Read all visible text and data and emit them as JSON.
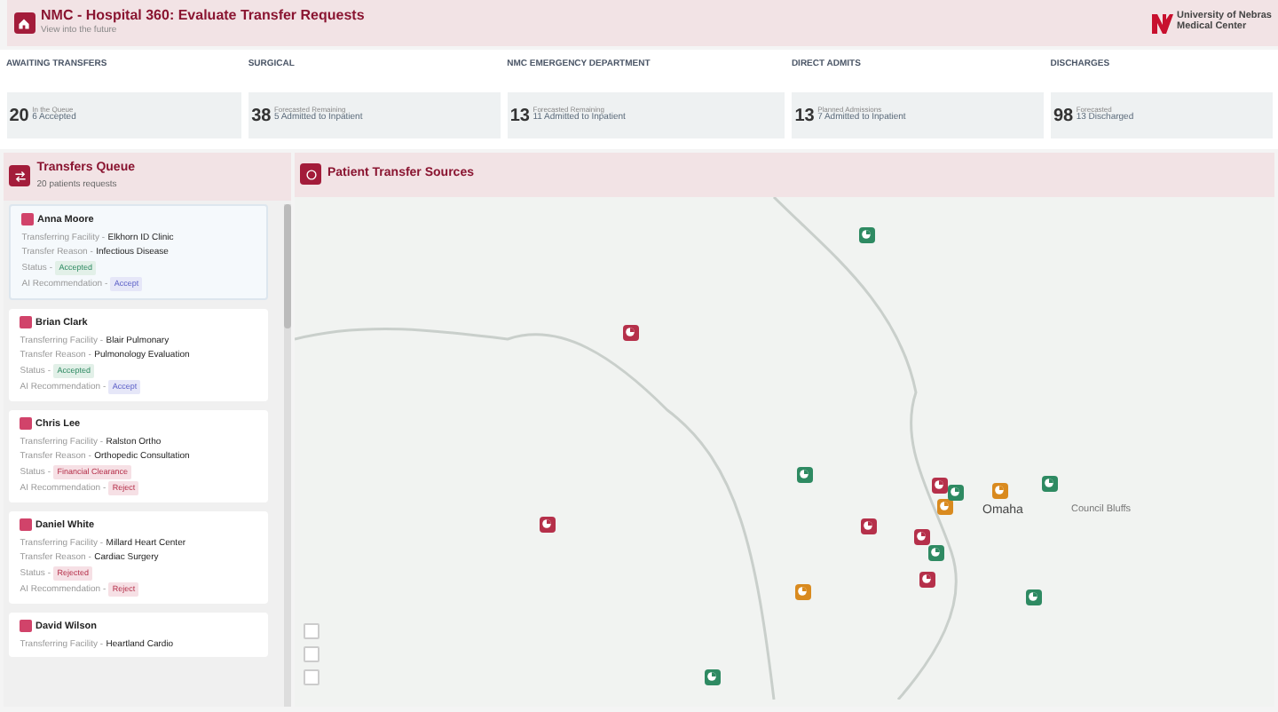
{
  "header": {
    "title": "NMC - Hospital 360: Evaluate Transfer Requests",
    "subtitle": "View into the future",
    "logo_lines": [
      "University of Nebras",
      "Medical Center"
    ]
  },
  "stats": [
    {
      "label": "AWAITING TRANSFERS",
      "number": "20",
      "caption": "In the Queue",
      "detail": "6 Accepted"
    },
    {
      "label": "SURGICAL",
      "number": "38",
      "caption": "Forecasted Remaining",
      "detail": "5 Admitted to Inpatient"
    },
    {
      "label": "NMC EMERGENCY DEPARTMENT",
      "number": "13",
      "caption": "Forecasted Remaining",
      "detail": "11 Admitted to Inpatient"
    },
    {
      "label": "DIRECT ADMITS",
      "number": "13",
      "caption": "Planned Admissions",
      "detail": "7 Admitted to Inpatient"
    },
    {
      "label": "DISCHARGES",
      "number": "98",
      "caption": "Forecasted",
      "detail": "13 Discharged"
    }
  ],
  "queue": {
    "title": "Transfers Queue",
    "subtitle": "20 patients requests",
    "patients": [
      {
        "name": "Anna Moore",
        "selected": true,
        "facility_label": "Transferring Facility -",
        "facility": "Elkhorn ID Clinic",
        "reason_label": "Transfer Reason -",
        "reason": "Infectious Disease",
        "status_label": "Status -",
        "status": {
          "text": "Accepted",
          "kind": "positive"
        },
        "ai_label": "AI Recommendation -",
        "ai": {
          "text": "Accept",
          "kind": "neutral"
        }
      },
      {
        "name": "Brian Clark",
        "selected": false,
        "facility_label": "Transferring Facility -",
        "facility": "Blair Pulmonary",
        "reason_label": "Transfer Reason -",
        "reason": "Pulmonology Evaluation",
        "status_label": "Status -",
        "status": {
          "text": "Accepted",
          "kind": "positive"
        },
        "ai_label": "AI Recommendation -",
        "ai": {
          "text": "Accept",
          "kind": "neutral"
        }
      },
      {
        "name": "Chris Lee",
        "selected": false,
        "facility_label": "Transferring Facility -",
        "facility": "Ralston Ortho",
        "reason_label": "Transfer Reason -",
        "reason": "Orthopedic Consultation",
        "status_label": "Status -",
        "status": {
          "text": "Financial Clearance",
          "kind": "negative"
        },
        "ai_label": "AI Recommendation -",
        "ai": {
          "text": "Reject",
          "kind": "negative"
        }
      },
      {
        "name": "Daniel White",
        "selected": false,
        "facility_label": "Transferring Facility -",
        "facility": "Millard Heart Center",
        "reason_label": "Transfer Reason -",
        "reason": "Cardiac Surgery",
        "status_label": "Status -",
        "status": {
          "text": "Rejected",
          "kind": "negative"
        },
        "ai_label": "AI Recommendation -",
        "ai": {
          "text": "Reject",
          "kind": "negative"
        }
      },
      {
        "name": "David Wilson",
        "selected": false,
        "facility_label": "Transferring Facility -",
        "facility": "Heartland Cardio"
      }
    ]
  },
  "map": {
    "title": "Patient Transfer Sources",
    "place_labels": [
      "Omaha",
      "Council Bluffs"
    ],
    "markers": [
      {
        "color": "#2e8a62"
      },
      {
        "color": "#b5304a"
      },
      {
        "color": "#b5304a"
      },
      {
        "color": "#2e8a62"
      },
      {
        "color": "#b5304a"
      },
      {
        "color": "#b5304a"
      },
      {
        "color": "#d98a1f"
      },
      {
        "color": "#2e8a62"
      },
      {
        "color": "#d98a1f"
      },
      {
        "color": "#2e8a62"
      },
      {
        "color": "#b5304a"
      },
      {
        "color": "#2e8a62"
      },
      {
        "color": "#b5304a"
      },
      {
        "color": "#d98a1f"
      },
      {
        "color": "#2e8a62"
      },
      {
        "color": "#2e8a62"
      }
    ]
  }
}
